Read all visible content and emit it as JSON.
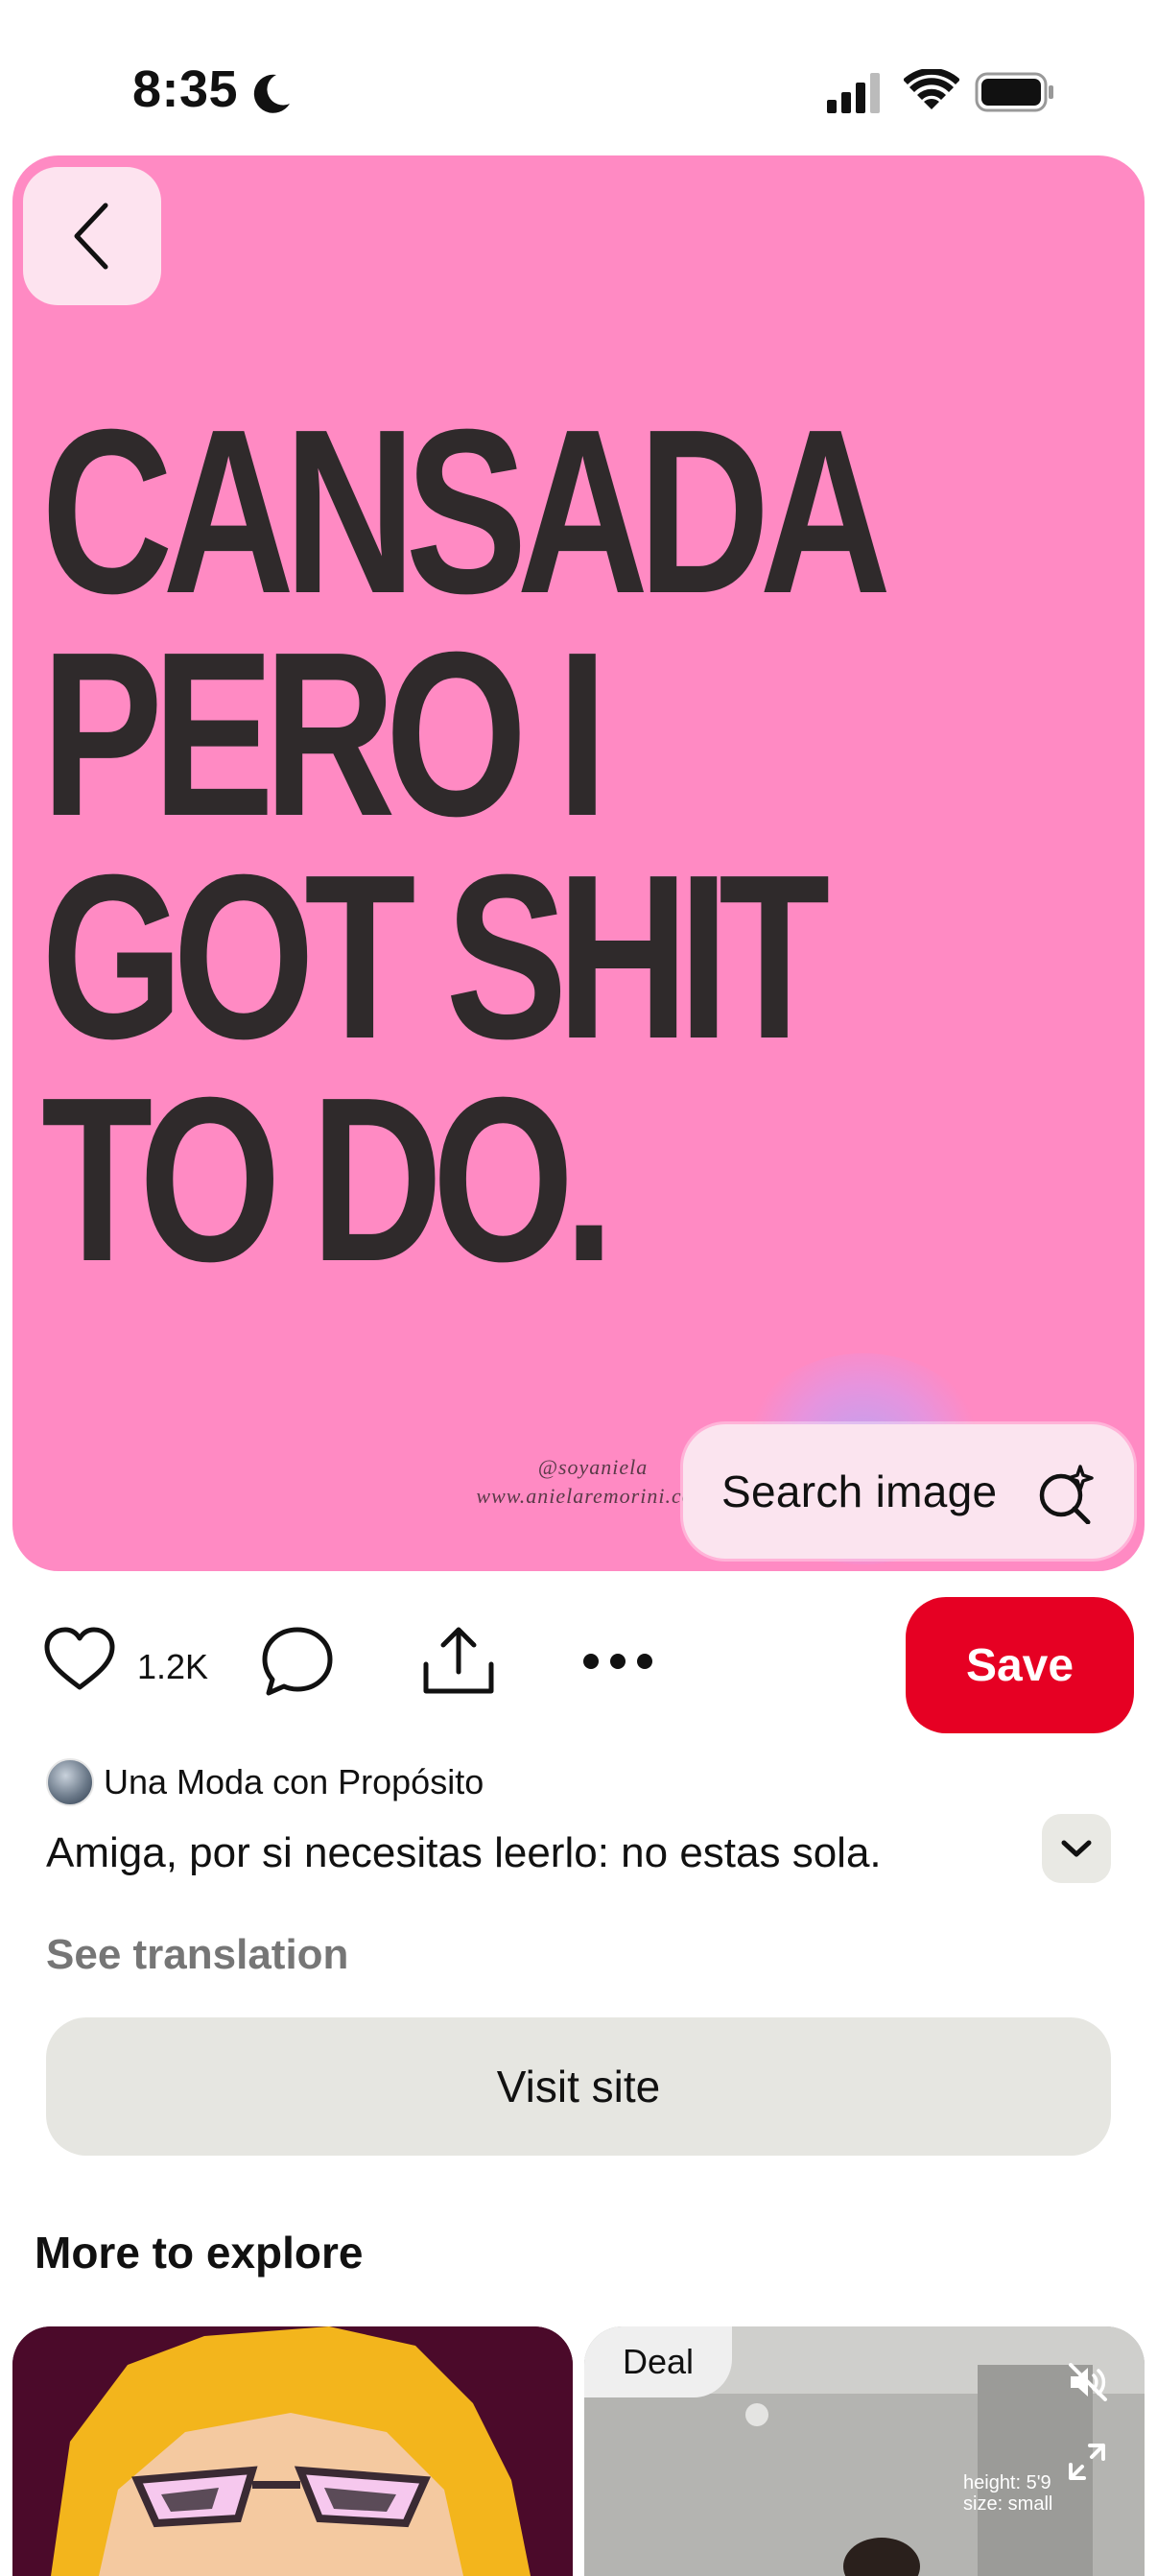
{
  "status_bar": {
    "time": "8:35"
  },
  "pin": {
    "lines": [
      "CANSADA",
      "PERO I",
      "GOT SHIT",
      "TO DO."
    ],
    "credit_handle": "@soyaniela",
    "credit_site": "www.anielaremorini.com",
    "search_image_label": "Search image",
    "background": "#ff8ac3"
  },
  "actions": {
    "like_count": "1.2K",
    "save_label": "Save",
    "accent": "#e60023"
  },
  "creator": {
    "name": "Una Moda con Propósito"
  },
  "description": "Amiga, por si necesitas leerlo: no estas sola.",
  "see_translation": "See translation",
  "visit_site": "Visit site",
  "more_to_explore": "More to explore",
  "explore": {
    "deal_badge": "Deal",
    "card2_lines": [
      "height: 5'9",
      "size: small"
    ]
  }
}
